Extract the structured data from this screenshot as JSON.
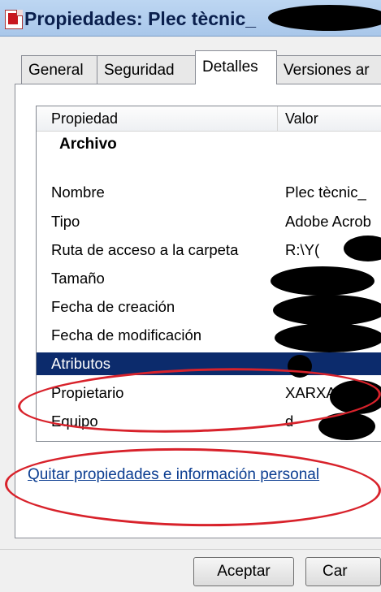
{
  "window": {
    "title": "Propiedades: Plec tècnic_"
  },
  "tabs": [
    {
      "label": "General"
    },
    {
      "label": "Seguridad"
    },
    {
      "label": "Detalles"
    },
    {
      "label": "Versiones ar"
    }
  ],
  "table": {
    "headers": {
      "property": "Propiedad",
      "value": "Valor"
    },
    "group": "Archivo",
    "rows": [
      {
        "name": "Nombre",
        "value": "Plec tècnic_"
      },
      {
        "name": "Tipo",
        "value": "Adobe Acrob"
      },
      {
        "name": "Ruta de acceso a la carpeta",
        "value": "R:\\Y("
      },
      {
        "name": "Tamaño",
        "value": ""
      },
      {
        "name": "Fecha de creación",
        "value": ""
      },
      {
        "name": "Fecha de modificación",
        "value": ""
      },
      {
        "name": "Atributos",
        "value": ""
      },
      {
        "name": "Propietario",
        "value": "XARXA"
      },
      {
        "name": "Equipo",
        "value": "d"
      }
    ]
  },
  "link": {
    "label": "Quitar propiedades e información personal"
  },
  "buttons": {
    "ok": "Aceptar",
    "cancel": "Car"
  },
  "colors": {
    "selected_row": "#0c2b6c",
    "annotation": "#d8222b",
    "link": "#0b3d91"
  }
}
